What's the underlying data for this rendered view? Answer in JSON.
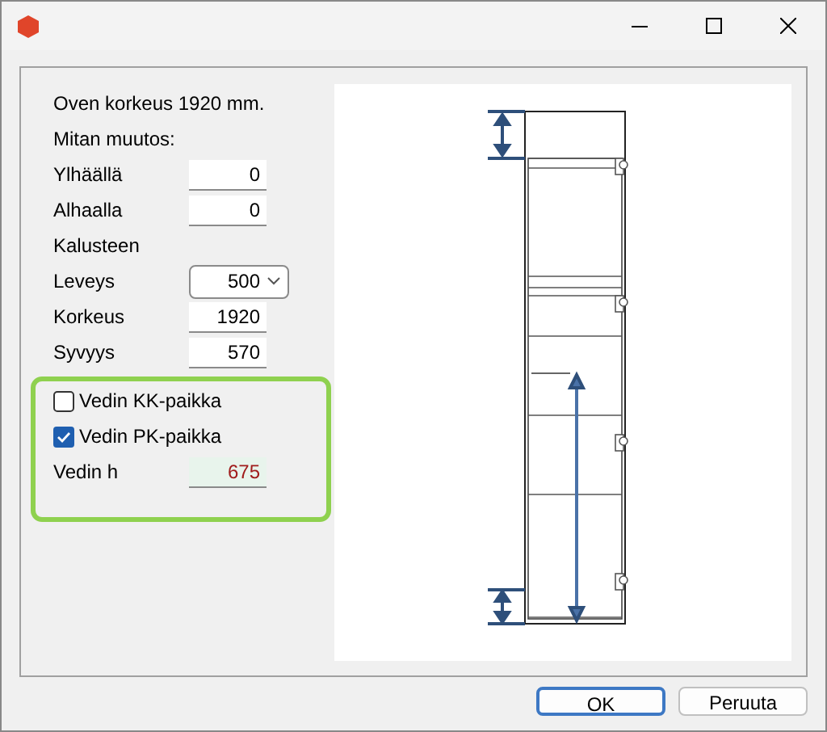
{
  "rows": [
    {
      "kind": "text",
      "label": "Oven korkeus 1920 mm."
    },
    {
      "kind": "text",
      "label": "Mitan muutos:"
    },
    {
      "kind": "field",
      "label": "Ylhäällä",
      "value": "0"
    },
    {
      "kind": "field",
      "label": "Alhaalla",
      "value": "0"
    },
    {
      "kind": "text",
      "label": "Kalusteen"
    },
    {
      "kind": "dropdown",
      "label": "Leveys",
      "value": "500"
    },
    {
      "kind": "field",
      "label": "Korkeus",
      "value": "1920"
    },
    {
      "kind": "field",
      "label": "Syvyys",
      "value": "570"
    }
  ],
  "highlight": {
    "rows": [
      {
        "kind": "checkbox",
        "label": "Vedin KK-paikka",
        "checked": false
      },
      {
        "kind": "checkbox",
        "label": "Vedin PK-paikka",
        "checked": true
      },
      {
        "kind": "computed-field",
        "label": "Vedin h",
        "value": "675"
      }
    ]
  },
  "buttons": [
    {
      "label": "OK",
      "default": true
    },
    {
      "label": "Peruuta",
      "default": false
    }
  ]
}
